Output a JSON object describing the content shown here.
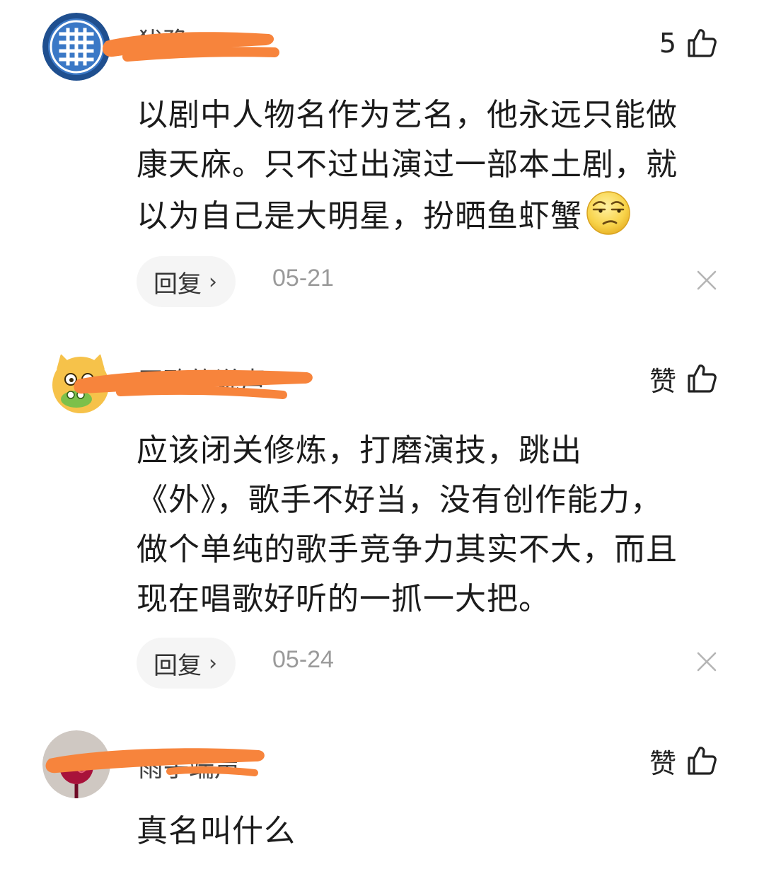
{
  "comments": [
    {
      "username": "犹豫",
      "like_label": "5",
      "body_lines": [
        "以剧中人物名作为艺名，他永远只能做",
        "康天庥。只不过出演过一部本土剧，就",
        "以为自己是大明星，扮晒鱼虾蟹"
      ],
      "emoji": "smug-face-emoji",
      "reply_label": "回复",
      "date": "05-21"
    },
    {
      "username": "王致的说声",
      "like_label": "赞",
      "body_lines": [
        "应该闭关修炼，打磨演技，跳出",
        "《外》，歌手不好当，没有创作能力，",
        "做个单纯的歌手竞争力其实不大，而且",
        "现在唱歌好听的一抓一大把。"
      ],
      "reply_label": "回复",
      "date": "05-24"
    },
    {
      "username": "雨子端声",
      "like_label": "赞",
      "body_lines": [
        "真名叫什么"
      ]
    }
  ],
  "icons": {
    "like": "thumbs-up-icon",
    "close": "close-icon",
    "chevron": "chevron-right-icon"
  },
  "colors": {
    "redaction": "#f7843c",
    "date": "#9a9a9a",
    "reply_bg": "#f5f5f5"
  }
}
